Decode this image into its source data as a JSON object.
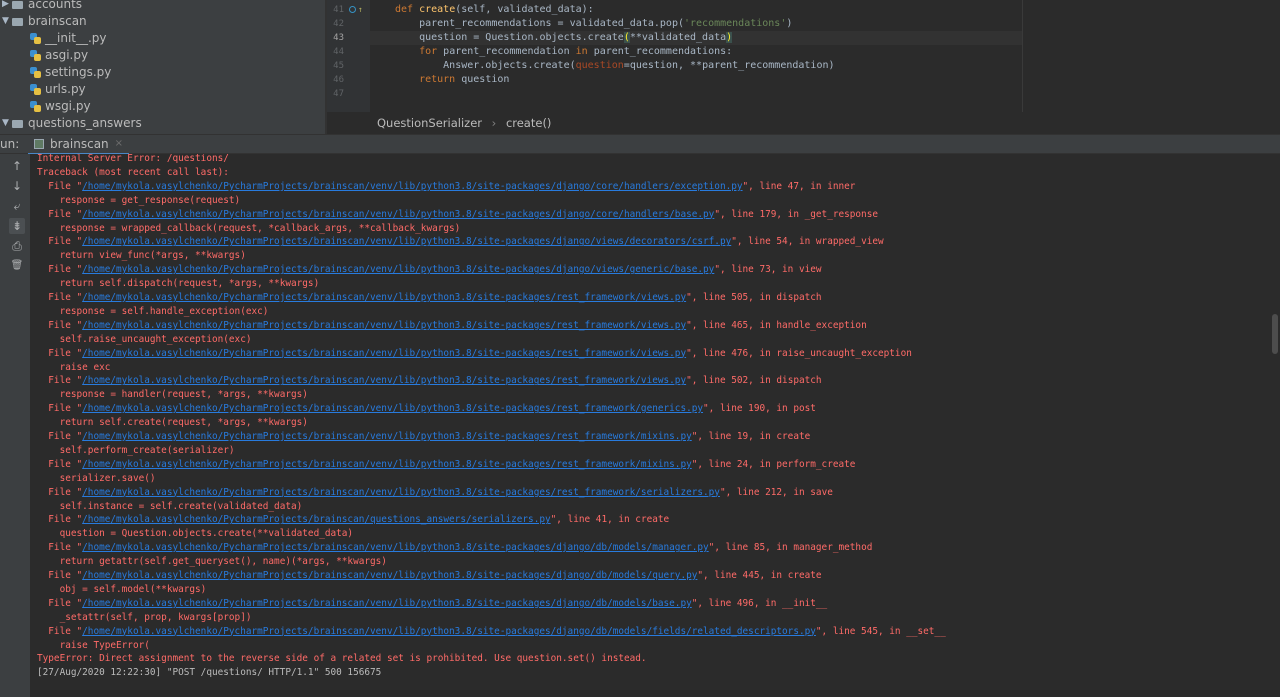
{
  "project_tree": {
    "rows": [
      {
        "kind": "folder",
        "expanded": false,
        "label": "accounts",
        "indent": 0
      },
      {
        "kind": "folder",
        "expanded": true,
        "label": "brainscan",
        "indent": 0
      },
      {
        "kind": "file",
        "label": "__init__.py",
        "indent": 1
      },
      {
        "kind": "file",
        "label": "asgi.py",
        "indent": 1
      },
      {
        "kind": "file",
        "label": "settings.py",
        "indent": 1
      },
      {
        "kind": "file",
        "label": "urls.py",
        "indent": 1
      },
      {
        "kind": "file",
        "label": "wsgi.py",
        "indent": 1
      },
      {
        "kind": "folder",
        "expanded": true,
        "label": "questions_answers",
        "indent": 0
      }
    ]
  },
  "editor": {
    "line_numbers": [
      "41",
      "42",
      "43",
      "44",
      "45",
      "46",
      "47"
    ],
    "current_line": "43",
    "breadcrumb": {
      "class_name": "QuestionSerializer",
      "separator": "›",
      "method": "create()"
    },
    "code": {
      "l41_kw": "def ",
      "l41_fn": "create",
      "l41_rest": "(self, validated_data):",
      "l42_a": "    parent_recommendations = validated_data.pop(",
      "l42_str": "'recommendations'",
      "l42_b": ")",
      "l43_a": "    question = Question.objects.create",
      "l43_p1": "(",
      "l43_mid": "**validated_data",
      "l43_p2": ")",
      "l44_kw1": "    for ",
      "l44_a": "parent_recommendation ",
      "l44_kw2": "in ",
      "l44_b": "parent_recommendations:",
      "l45_a": "        Answer.objects.create(",
      "l45_pm": "question",
      "l45_b": "=question, **parent_recommendation)",
      "l46_kw": "    return ",
      "l46_a": "question"
    }
  },
  "run_panel": {
    "label": "un:",
    "tab_label": "brainscan",
    "tab_close": "×",
    "tools": [
      "↑",
      "↓",
      "⤶",
      "⇟",
      "⎙",
      "🗑"
    ]
  },
  "console": {
    "lines": [
      {
        "text": "Internal Server Error: /questions/"
      },
      {
        "text": "Traceback (most recent call last):"
      },
      {
        "pre": "  File \"",
        "link": "/home/mykola.vasylchenko/PycharmProjects/brainscan/venv/lib/python3.8/site-packages/django/core/handlers/exception.py",
        "post": "\", line 47, in inner"
      },
      {
        "text": "    response = get_response(request)"
      },
      {
        "pre": "  File \"",
        "link": "/home/mykola.vasylchenko/PycharmProjects/brainscan/venv/lib/python3.8/site-packages/django/core/handlers/base.py",
        "post": "\", line 179, in _get_response"
      },
      {
        "text": "    response = wrapped_callback(request, *callback_args, **callback_kwargs)"
      },
      {
        "pre": "  File \"",
        "link": "/home/mykola.vasylchenko/PycharmProjects/brainscan/venv/lib/python3.8/site-packages/django/views/decorators/csrf.py",
        "post": "\", line 54, in wrapped_view"
      },
      {
        "text": "    return view_func(*args, **kwargs)"
      },
      {
        "pre": "  File \"",
        "link": "/home/mykola.vasylchenko/PycharmProjects/brainscan/venv/lib/python3.8/site-packages/django/views/generic/base.py",
        "post": "\", line 73, in view"
      },
      {
        "text": "    return self.dispatch(request, *args, **kwargs)"
      },
      {
        "pre": "  File \"",
        "link": "/home/mykola.vasylchenko/PycharmProjects/brainscan/venv/lib/python3.8/site-packages/rest_framework/views.py",
        "post": "\", line 505, in dispatch"
      },
      {
        "text": "    response = self.handle_exception(exc)"
      },
      {
        "pre": "  File \"",
        "link": "/home/mykola.vasylchenko/PycharmProjects/brainscan/venv/lib/python3.8/site-packages/rest_framework/views.py",
        "post": "\", line 465, in handle_exception"
      },
      {
        "text": "    self.raise_uncaught_exception(exc)"
      },
      {
        "pre": "  File \"",
        "link": "/home/mykola.vasylchenko/PycharmProjects/brainscan/venv/lib/python3.8/site-packages/rest_framework/views.py",
        "post": "\", line 476, in raise_uncaught_exception"
      },
      {
        "text": "    raise exc"
      },
      {
        "pre": "  File \"",
        "link": "/home/mykola.vasylchenko/PycharmProjects/brainscan/venv/lib/python3.8/site-packages/rest_framework/views.py",
        "post": "\", line 502, in dispatch"
      },
      {
        "text": "    response = handler(request, *args, **kwargs)"
      },
      {
        "pre": "  File \"",
        "link": "/home/mykola.vasylchenko/PycharmProjects/brainscan/venv/lib/python3.8/site-packages/rest_framework/generics.py",
        "post": "\", line 190, in post"
      },
      {
        "text": "    return self.create(request, *args, **kwargs)"
      },
      {
        "pre": "  File \"",
        "link": "/home/mykola.vasylchenko/PycharmProjects/brainscan/venv/lib/python3.8/site-packages/rest_framework/mixins.py",
        "post": "\", line 19, in create"
      },
      {
        "text": "    self.perform_create(serializer)"
      },
      {
        "pre": "  File \"",
        "link": "/home/mykola.vasylchenko/PycharmProjects/brainscan/venv/lib/python3.8/site-packages/rest_framework/mixins.py",
        "post": "\", line 24, in perform_create"
      },
      {
        "text": "    serializer.save()"
      },
      {
        "pre": "  File \"",
        "link": "/home/mykola.vasylchenko/PycharmProjects/brainscan/venv/lib/python3.8/site-packages/rest_framework/serializers.py",
        "post": "\", line 212, in save"
      },
      {
        "text": "    self.instance = self.create(validated_data)"
      },
      {
        "pre": "  File \"",
        "link": "/home/mykola.vasylchenko/PycharmProjects/brainscan/questions_answers/serializers.py",
        "post": "\", line 41, in create"
      },
      {
        "text": "    question = Question.objects.create(**validated_data)"
      },
      {
        "pre": "  File \"",
        "link": "/home/mykola.vasylchenko/PycharmProjects/brainscan/venv/lib/python3.8/site-packages/django/db/models/manager.py",
        "post": "\", line 85, in manager_method"
      },
      {
        "text": "    return getattr(self.get_queryset(), name)(*args, **kwargs)"
      },
      {
        "pre": "  File \"",
        "link": "/home/mykola.vasylchenko/PycharmProjects/brainscan/venv/lib/python3.8/site-packages/django/db/models/query.py",
        "post": "\", line 445, in create"
      },
      {
        "text": "    obj = self.model(**kwargs)"
      },
      {
        "pre": "  File \"",
        "link": "/home/mykola.vasylchenko/PycharmProjects/brainscan/venv/lib/python3.8/site-packages/django/db/models/base.py",
        "post": "\", line 496, in __init__"
      },
      {
        "text": "    _setattr(self, prop, kwargs[prop])"
      },
      {
        "pre": "  File \"",
        "link": "/home/mykola.vasylchenko/PycharmProjects/brainscan/venv/lib/python3.8/site-packages/django/db/models/fields/related_descriptors.py",
        "post": "\", line 545, in __set__"
      },
      {
        "text": "    raise TypeError("
      },
      {
        "text": "TypeError: Direct assignment to the reverse side of a related set is prohibited. Use question.set() instead."
      },
      {
        "text": "[27/Aug/2020 12:22:30] \"POST /questions/ HTTP/1.1\" 500 156675"
      }
    ]
  }
}
